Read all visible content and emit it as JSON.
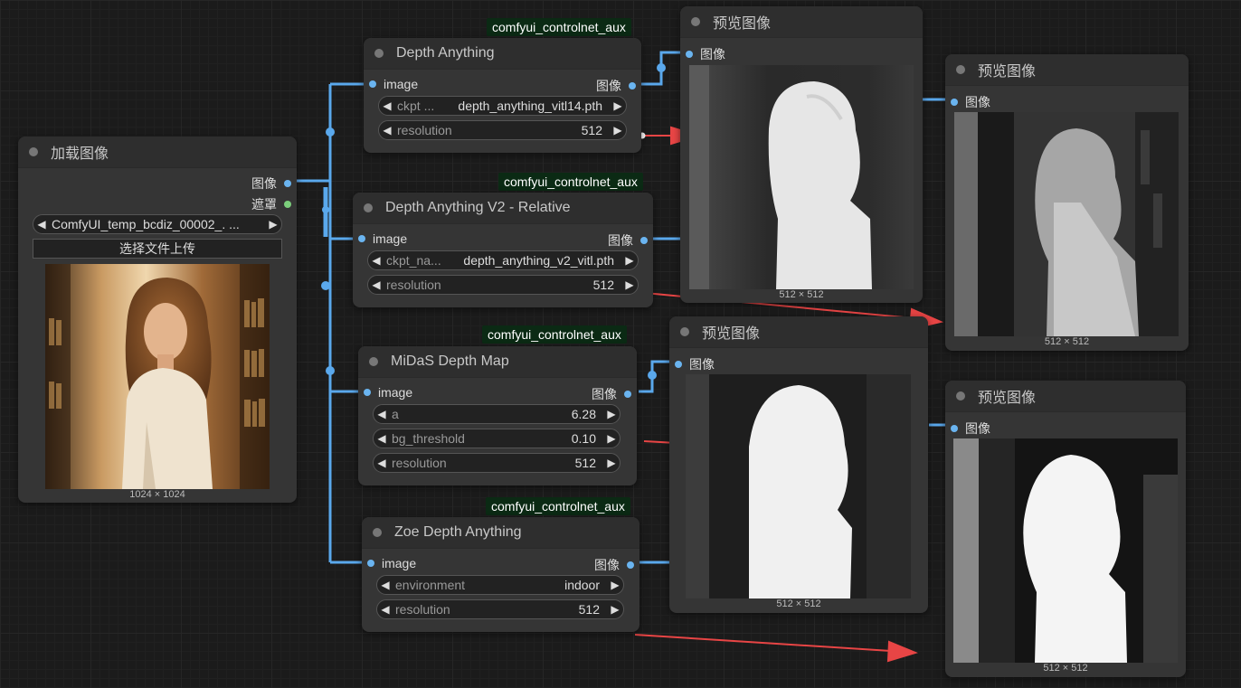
{
  "badge_text": "comfyui_controlnet_aux",
  "load_node": {
    "title": "加载图像",
    "out_image": "图像",
    "out_mask": "遮罩",
    "file_value": "ComfyUI_temp_bcdiz_00002_. ...",
    "upload_label": "选择文件上传",
    "caption": "1024 × 1024"
  },
  "depth_anything": {
    "title": "Depth Anything",
    "in_label": "image",
    "out_label": "图像",
    "w1_name": "ckpt ...",
    "w1_value": "depth_anything_vitl14.pth",
    "w2_name": "resolution",
    "w2_value": "512"
  },
  "depth_v2": {
    "title": "Depth Anything V2 - Relative",
    "in_label": "image",
    "out_label": "图像",
    "w1_name": "ckpt_na...",
    "w1_value": "depth_anything_v2_vitl.pth",
    "w2_name": "resolution",
    "w2_value": "512"
  },
  "midas": {
    "title": "MiDaS Depth Map",
    "in_label": "image",
    "out_label": "图像",
    "w1_name": "a",
    "w1_value": "6.28",
    "w2_name": "bg_threshold",
    "w2_value": "0.10",
    "w3_name": "resolution",
    "w3_value": "512"
  },
  "zoe": {
    "title": "Zoe Depth Anything",
    "in_label": "image",
    "out_label": "图像",
    "w1_name": "environment",
    "w1_value": "indoor",
    "w2_name": "resolution",
    "w2_value": "512"
  },
  "preview1": {
    "title": "预览图像",
    "in_label": "图像",
    "caption": "512 × 512"
  },
  "preview2": {
    "title": "预览图像",
    "in_label": "图像",
    "caption": "512 × 512"
  },
  "preview3": {
    "title": "预览图像",
    "in_label": "图像",
    "caption": "512 × 512"
  },
  "preview4": {
    "title": "预览图像",
    "in_label": "图像",
    "caption": "512 × 512"
  },
  "colors": {
    "wire": "#5aa8ec",
    "arrow": "#e84545",
    "badge_bg": "#0b2a14",
    "node_bg": "#353535"
  }
}
